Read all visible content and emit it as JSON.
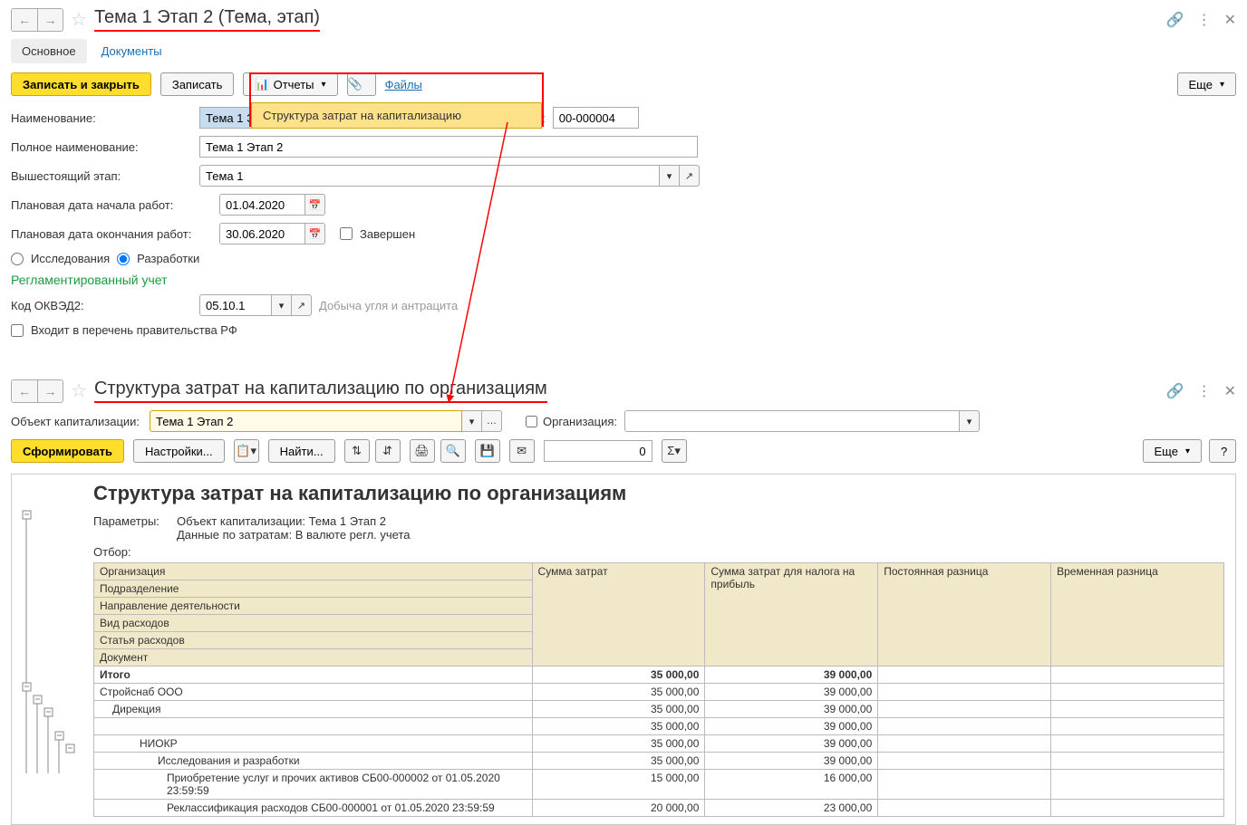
{
  "panel1": {
    "title": "Тема 1 Этап 2 (Тема, этап)",
    "tabs": {
      "main": "Основное",
      "docs": "Документы"
    },
    "toolbar": {
      "save_close": "Записать и закрыть",
      "save": "Записать",
      "reports": "Отчеты",
      "files": "Файлы",
      "more": "Еще"
    },
    "dropdown_item": "Структура затрат на капитализацию",
    "fields": {
      "name_label": "Наименование:",
      "name_value": "Тема 1 Эт",
      "code_label": "Код:",
      "code_value": "00-000004",
      "full_name_label": "Полное наименование:",
      "full_name_value": "Тема 1 Этап 2",
      "parent_label": "Вышестоящий этап:",
      "parent_value": "Тема 1",
      "start_label": "Плановая дата начала работ:",
      "start_value": "01.04.2020",
      "end_label": "Плановая дата окончания работ:",
      "end_value": "30.06.2020",
      "completed": "Завершен",
      "radio1": "Исследования",
      "radio2": "Разработки",
      "section": "Регламентированный учет",
      "okved_label": "Код ОКВЭД2:",
      "okved_value": "05.10.1",
      "okved_hint": "Добыча угля и антрацита",
      "gov_list": "Входит в перечень правительства РФ"
    }
  },
  "panel2": {
    "title": "Структура затрат на капитализацию по организациям",
    "obj_label": "Объект капитализации:",
    "obj_value": "Тема 1 Этап 2",
    "org_label": "Организация:",
    "toolbar": {
      "generate": "Сформировать",
      "settings": "Настройки...",
      "find": "Найти...",
      "zero": "0",
      "more": "Еще",
      "help": "?"
    },
    "report": {
      "title": "Структура затрат на капитализацию по организациям",
      "param_label": "Параметры:",
      "param1": "Объект капитализации: Тема 1 Этап 2",
      "param2": "Данные по затратам: В валюте регл. учета",
      "filter_label": "Отбор:",
      "headers": {
        "h1_1": "Организация",
        "h1_2": "Подразделение",
        "h1_3": "Направление деятельности",
        "h1_4": "Вид расходов",
        "h1_5": "Статья расходов",
        "h1_6": "Документ",
        "h2": "Сумма затрат",
        "h3": "Сумма затрат для налога на прибыль",
        "h4": "Постоянная разница",
        "h5": "Временная разница"
      },
      "rows": [
        {
          "label": "Итого",
          "c2": "35 000,00",
          "c3": "39 000,00",
          "bold": true,
          "indent": 0
        },
        {
          "label": "Стройснаб ООО",
          "c2": "35 000,00",
          "c3": "39 000,00",
          "indent": 0
        },
        {
          "label": "Дирекция",
          "c2": "35 000,00",
          "c3": "39 000,00",
          "indent": 1
        },
        {
          "label": "",
          "c2": "35 000,00",
          "c3": "39 000,00",
          "indent": 1
        },
        {
          "label": "НИОКР",
          "c2": "35 000,00",
          "c3": "39 000,00",
          "indent": 2
        },
        {
          "label": "Исследования и разработки",
          "c2": "35 000,00",
          "c3": "39 000,00",
          "indent": 3
        },
        {
          "label": "Приобретение услуг и прочих активов СБ00-000002 от 01.05.2020 23:59:59",
          "c2": "15 000,00",
          "c3": "16 000,00",
          "indent": 4
        },
        {
          "label": "Реклассификация расходов СБ00-000001 от 01.05.2020 23:59:59",
          "c2": "20 000,00",
          "c3": "23 000,00",
          "indent": 4
        }
      ]
    }
  }
}
